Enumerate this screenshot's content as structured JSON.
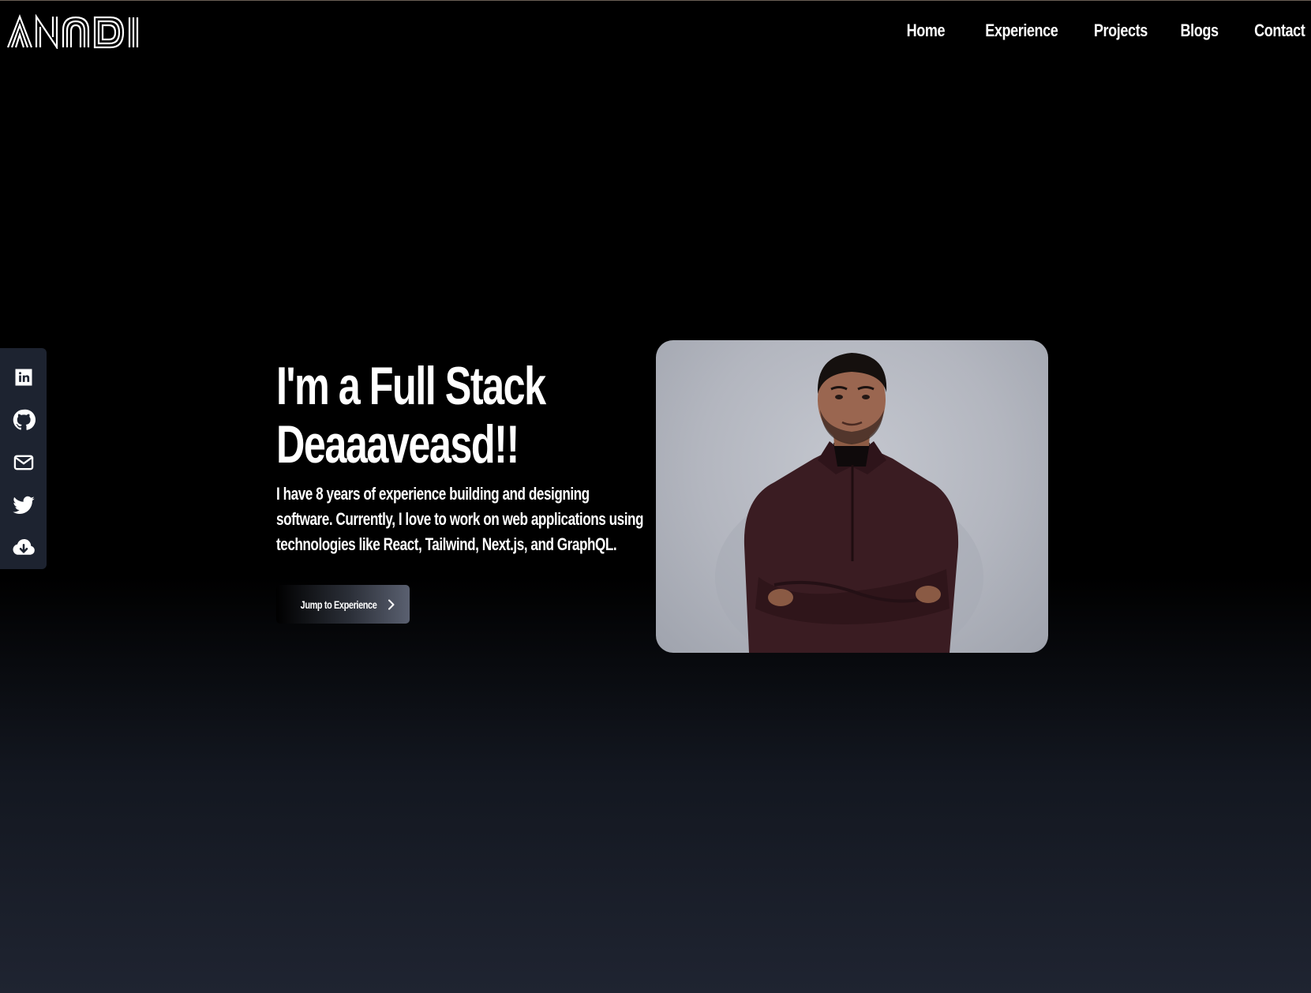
{
  "brand": {
    "logo_text": "ANADI"
  },
  "nav": {
    "items": [
      "Home",
      "Experience",
      "Projects",
      "Blogs",
      "Contact"
    ]
  },
  "social": {
    "icons": [
      "linkedin-icon",
      "github-icon",
      "mail-icon",
      "twitter-icon",
      "cloud-download-icon"
    ]
  },
  "hero": {
    "headline_line1": "I'm a Full Stack",
    "headline_line2": "Deaaaveasd!!",
    "bio": "I have 8 years of experience building and designing software. Currently, I love to work on web applications using technologies like React, Tailwind, Next.js, and GraphQL.",
    "cta_label": "Jump to Experience"
  },
  "colors": {
    "background_top": "#000000",
    "background_bottom": "#1f2431",
    "social_bar": "#1d2330",
    "text": "#ffffff"
  }
}
